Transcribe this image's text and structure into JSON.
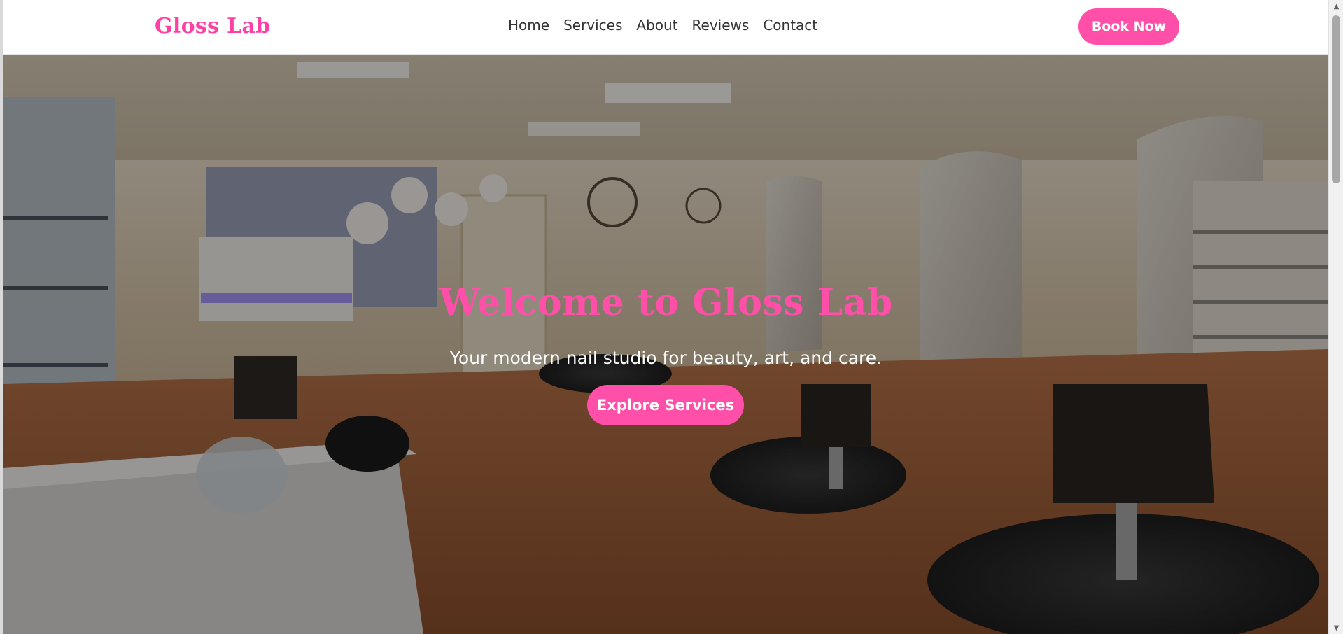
{
  "brand": {
    "name": "Gloss Lab",
    "color": "#ff3fa3"
  },
  "nav": {
    "links": [
      "Home",
      "Services",
      "About",
      "Reviews",
      "Contact"
    ],
    "cta_label": "Book Now"
  },
  "hero": {
    "title": "Welcome to Gloss Lab",
    "subtitle": "Your modern nail studio for beauty, art, and care.",
    "cta_label": "Explore Services",
    "background_image": "salon-interior"
  },
  "colors": {
    "accent": "#ff4fa8",
    "nav_text": "#333333",
    "hero_text": "#ffffff"
  },
  "icons": {
    "scroll_up": "triangle-up-icon",
    "scroll_down": "triangle-down-icon"
  }
}
